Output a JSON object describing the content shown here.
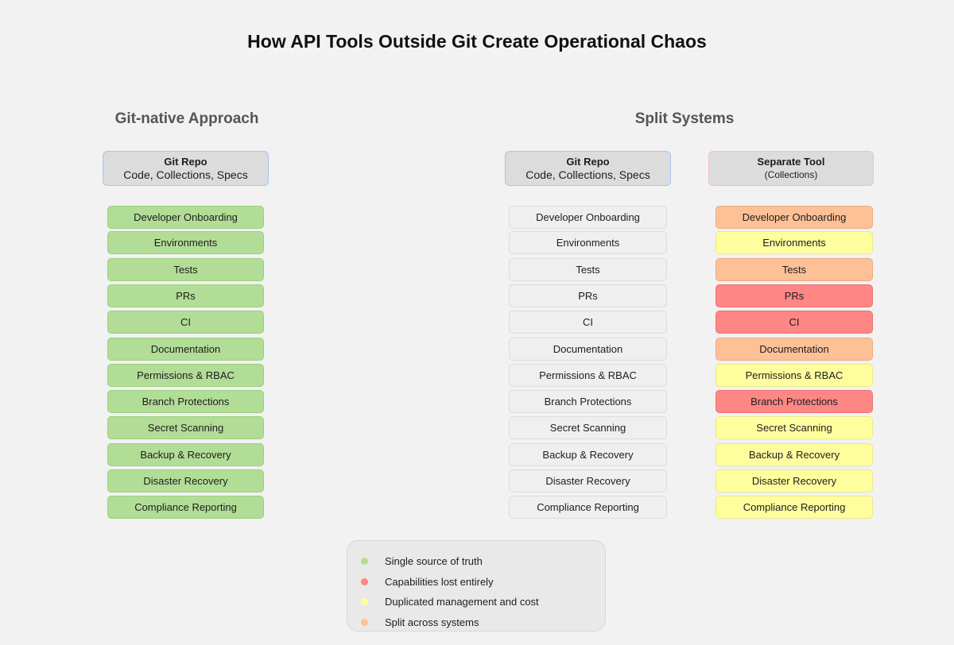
{
  "title": "How API Tools Outside Git Create Operational Chaos",
  "sections": {
    "left": "Git-native Approach",
    "right": "Split Systems"
  },
  "headers": {
    "git_native": {
      "title": "Git Repo",
      "subtitle": "Code, Collections, Specs"
    },
    "split_git": {
      "title": "Git Repo",
      "subtitle": "Code, Collections, Specs"
    },
    "separate_tool": {
      "title": "Separate Tool",
      "subtitle": "(Collections)"
    }
  },
  "capabilities": [
    {
      "label": "Developer Onboarding",
      "git_native": "green",
      "split_git": "gray",
      "separate_tool": "orange"
    },
    {
      "label": "Environments",
      "git_native": "green",
      "split_git": "gray",
      "separate_tool": "yellow"
    },
    {
      "label": "Tests",
      "git_native": "green",
      "split_git": "gray",
      "separate_tool": "orange"
    },
    {
      "label": "PRs",
      "git_native": "green",
      "split_git": "gray",
      "separate_tool": "red"
    },
    {
      "label": "CI",
      "git_native": "green",
      "split_git": "gray",
      "separate_tool": "red"
    },
    {
      "label": "Documentation",
      "git_native": "green",
      "split_git": "gray",
      "separate_tool": "orange"
    },
    {
      "label": "Permissions & RBAC",
      "git_native": "green",
      "split_git": "gray",
      "separate_tool": "yellow"
    },
    {
      "label": "Branch Protections",
      "git_native": "green",
      "split_git": "gray",
      "separate_tool": "red"
    },
    {
      "label": "Secret Scanning",
      "git_native": "green",
      "split_git": "gray",
      "separate_tool": "yellow"
    },
    {
      "label": "Backup & Recovery",
      "git_native": "green",
      "split_git": "gray",
      "separate_tool": "yellow"
    },
    {
      "label": "Disaster Recovery",
      "git_native": "green",
      "split_git": "gray",
      "separate_tool": "yellow"
    },
    {
      "label": "Compliance Reporting",
      "git_native": "green",
      "split_git": "gray",
      "separate_tool": "yellow"
    }
  ],
  "legend": [
    {
      "label": "Single source of truth",
      "color": "#b2dd96"
    },
    {
      "label": "Capabilities lost entirely",
      "color": "#fe8685"
    },
    {
      "label": "Duplicated management and cost",
      "color": "#fefe9f"
    },
    {
      "label": "Split across systems",
      "color": "#fec096"
    }
  ],
  "colors": {
    "green": "#b2dd96",
    "gray": "#efefef",
    "red": "#fe8685",
    "yellow": "#fefe9f",
    "orange": "#fec096"
  }
}
